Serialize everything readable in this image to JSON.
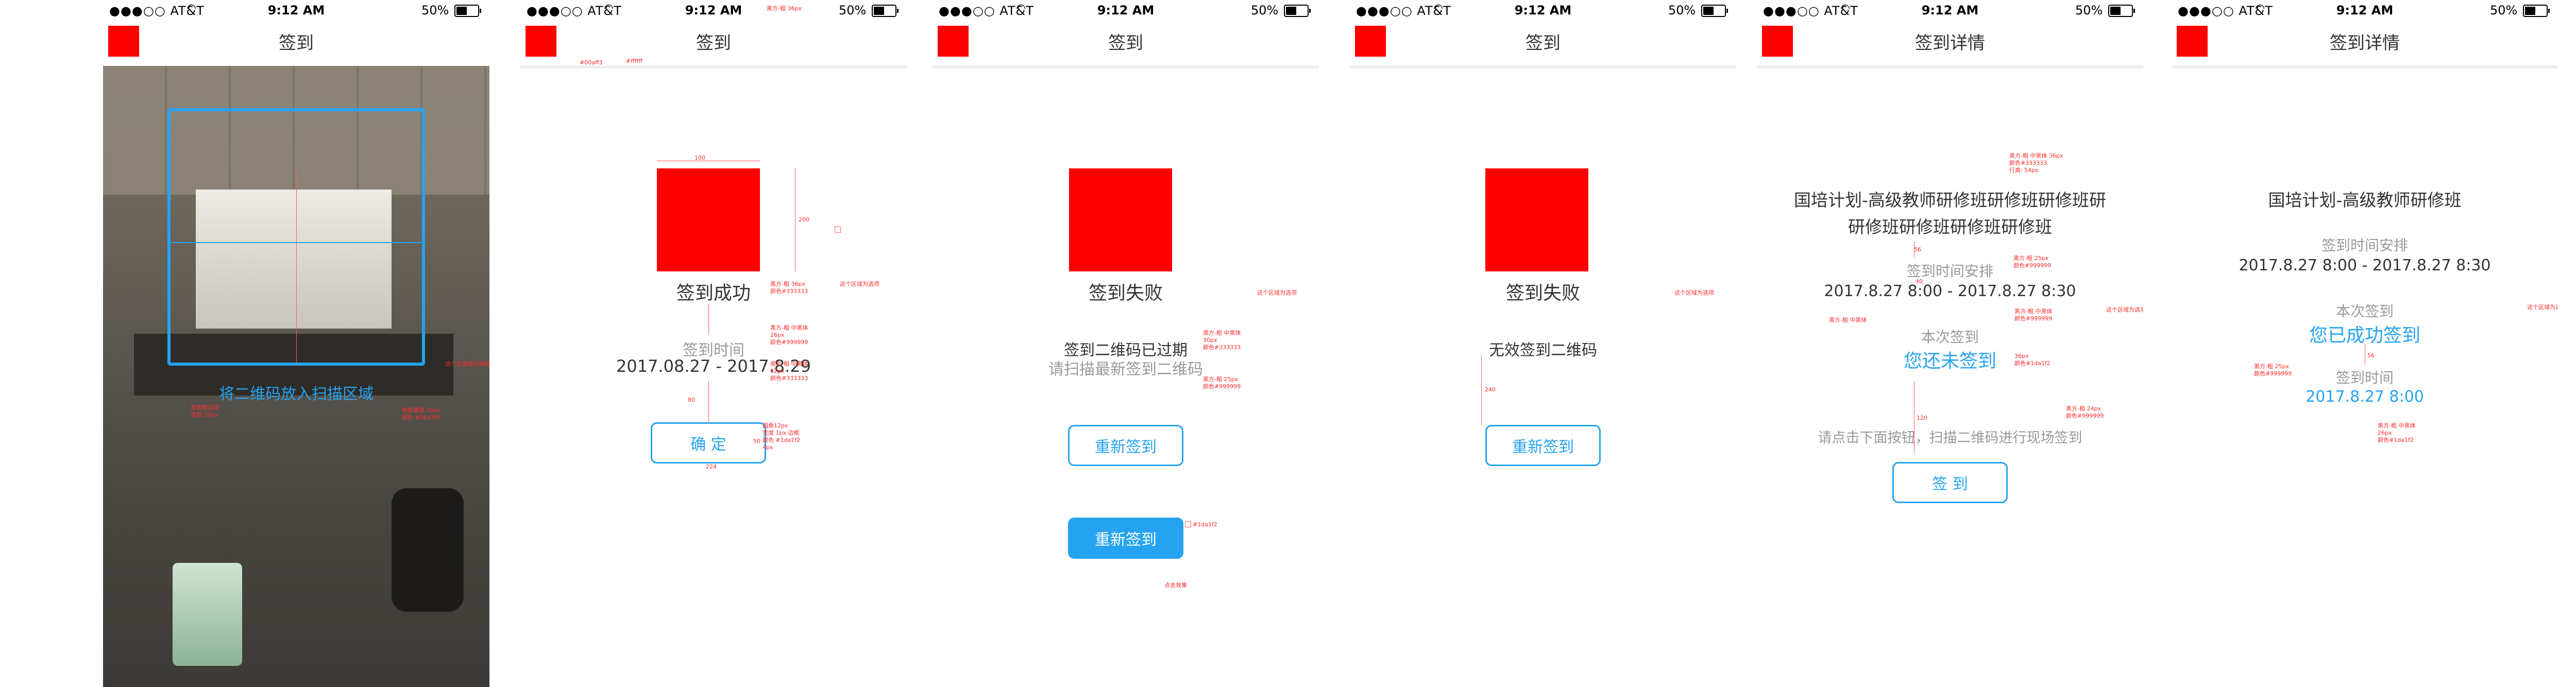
{
  "status": {
    "carrier": "●●●○○ AT&T",
    "wifi": "wifi-icon",
    "time": "9:12 AM",
    "battery": "50%"
  },
  "colors": {
    "accent": "#26a3f0",
    "placeholder_red": "#ff0000",
    "text_dark": "#333333",
    "text_gray": "#999999"
  },
  "screens": {
    "scan": {
      "nav_title": "签到",
      "hint": "将二维码放入扫描区域"
    },
    "success": {
      "nav_title": "签到",
      "result_title": "签到成功",
      "time_label": "签到时间",
      "time_value": "2017.08.27 - 2017.8.29",
      "confirm": "确 定"
    },
    "expired": {
      "nav_title": "签到",
      "result_title": "签到失败",
      "message": "签到二维码已过期",
      "sub_message": "请扫描最新签到二维码",
      "retry": "重新签到",
      "retry_pressed": "重新签到"
    },
    "invalid": {
      "nav_title": "签到",
      "result_title": "签到失败",
      "message": "无效签到二维码",
      "retry": "重新签到"
    },
    "detail_unsigned": {
      "nav_title": "签到详情",
      "course_line1": "国培计划-高级教师研修班研修班研修班研",
      "course_line2": "研修班研修班研修班研修班",
      "schedule_label": "签到时间安排",
      "schedule_value": "2017.8.27 8:00 - 2017.8.27 8:30",
      "this_time_label": "本次签到",
      "status": "您还未签到",
      "instruction": "请点击下面按钮，扫描二维码进行现场签到",
      "sign_button": "签 到"
    },
    "detail_signed": {
      "nav_title": "签到详情",
      "course": "国培计划-高级教师研修班",
      "schedule_label": "签到时间安排",
      "schedule_value": "2017.8.27 8:00 - 2017.8.27 8:30",
      "this_time_label": "本次签到",
      "status": "您已成功签到",
      "signed_time_label": "签到时间",
      "signed_time_value": "2017.8.27 8:00"
    }
  },
  "annotations": {
    "scan": [
      "签到框区域",
      "宽度 10px",
      "微软雅黑 30px",
      "颜色 #26a3f0",
      "这个区域是扫描框"
    ],
    "success": [
      "黑方-粗 36px",
      "颜色#333333",
      "#00aff3",
      "#ffffff",
      "这个区域为选项",
      "黑方-粗 中黑体",
      "26px",
      "颜色#999999",
      "黑方-粗 中黑体",
      "32px",
      "颜色#333333",
      "圆角12px",
      "宽度 1px 边框",
      "颜色 #1da1f2",
      "4px",
      "224",
      "200",
      "100",
      "80",
      "50"
    ],
    "expired": [
      "黑方-粗 中黑体",
      "30px",
      "颜色#333333",
      "黑方-粗 25px",
      "颜色#999999",
      "这个区域为选项",
      "#1da1f2",
      "点击效果"
    ],
    "invalid": [
      "这个区域为选项",
      "黑方-粗 中黑体",
      "240"
    ],
    "detail_unsigned": [
      "黑方-粗 中黑体 36px",
      "颜色#333333",
      "行高: 54px",
      "黑方-粗 25px",
      "颜色#999999",
      "黑方-粗 中黑体",
      "颜色#999999",
      "黑方-粗 中黑体",
      "36px",
      "颜色#1da1f2",
      "黑方-粗 24px",
      "颜色#999999",
      "这个区域为选项",
      "120",
      "56",
      "40"
    ],
    "detail_signed": [
      "这个区域为选项",
      "黑方-粗 25px",
      "颜色#999999",
      "黑方-粗 中黑体",
      "26px",
      "颜色#1da1f2",
      "56"
    ]
  }
}
